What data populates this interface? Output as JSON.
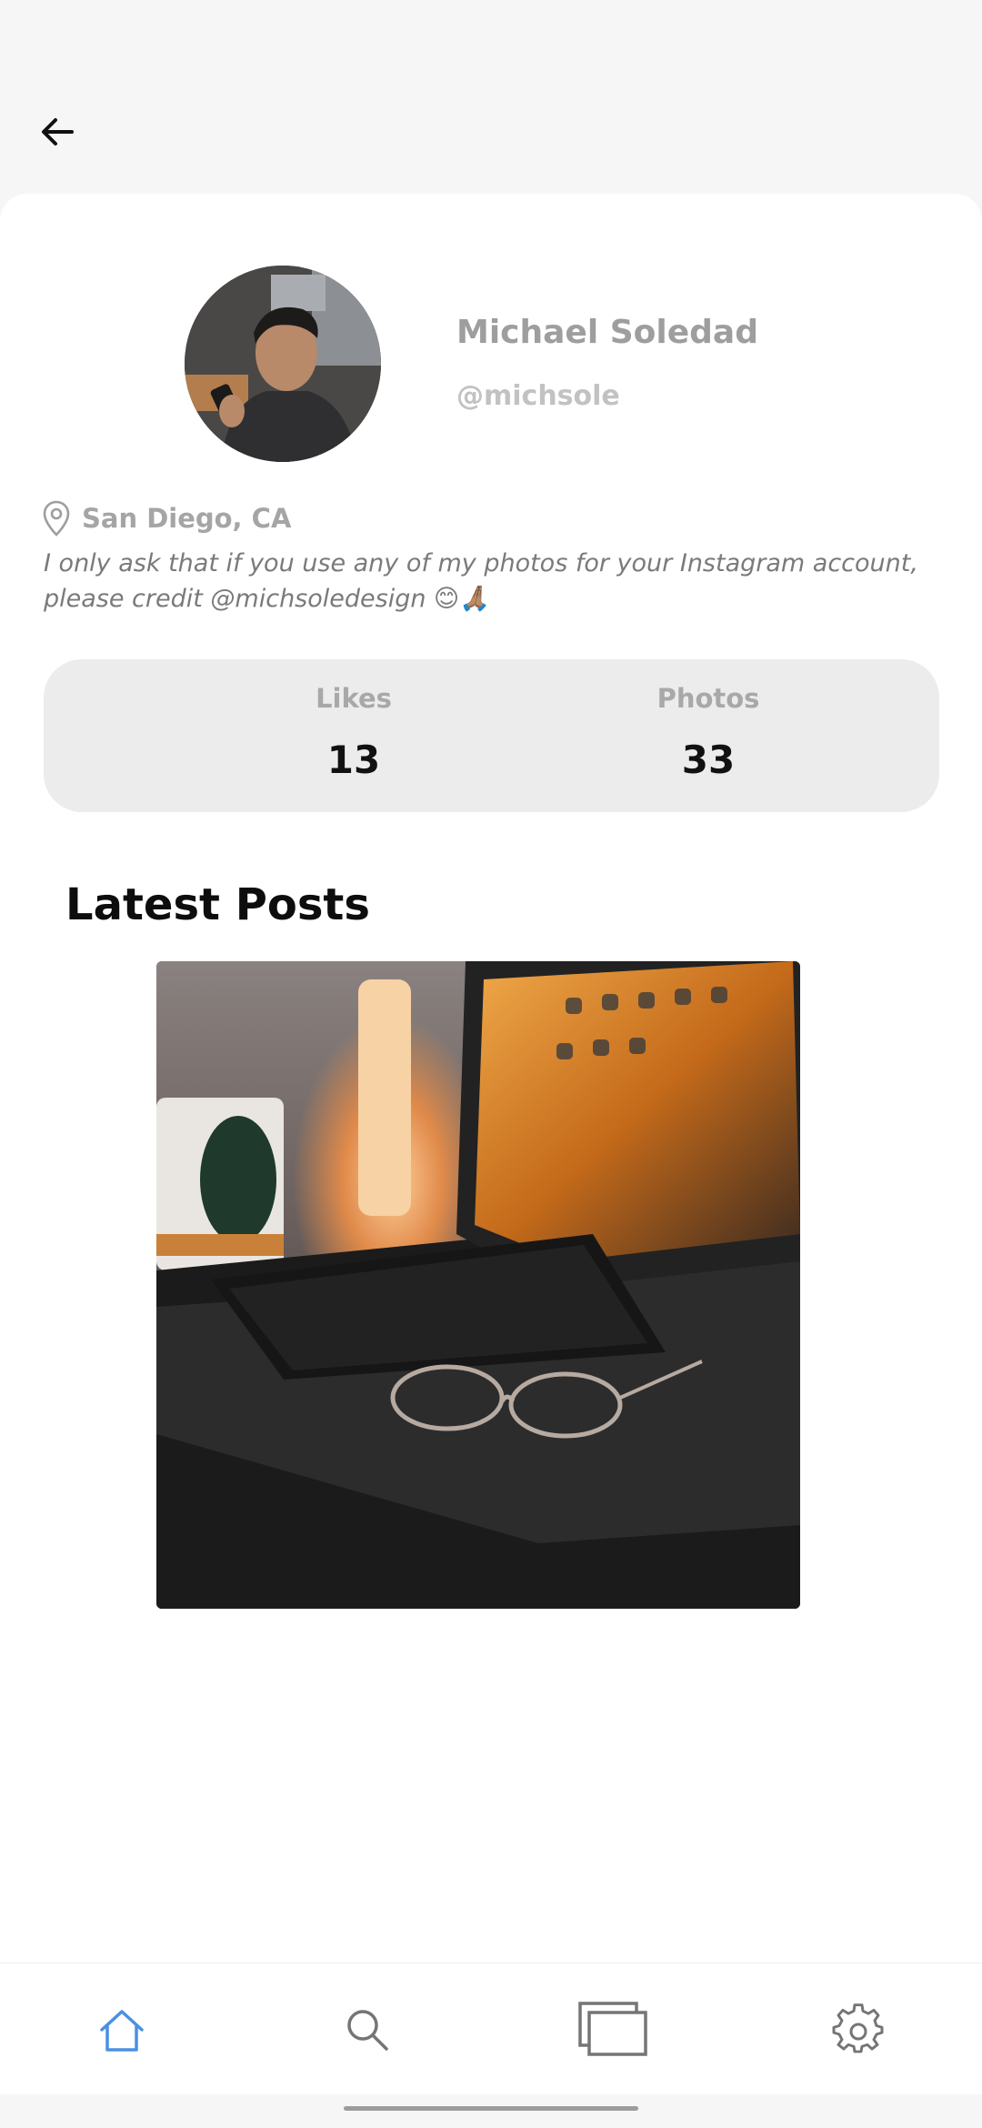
{
  "header": {
    "back_icon": "arrow-left-icon"
  },
  "profile": {
    "name": "Michael Soledad",
    "handle": "@michsole",
    "location": "San Diego, CA",
    "bio": "I only ask that if you use any of my photos for your Instagram account, please credit @michsoledesign 😊🙏🏽"
  },
  "stats": {
    "likes_label": "Likes",
    "likes_value": "13",
    "photos_label": "Photos",
    "photos_value": "33"
  },
  "posts": {
    "title": "Latest Posts"
  },
  "bottom_nav": {
    "items": [
      {
        "icon": "home-icon",
        "active": true
      },
      {
        "icon": "search-icon",
        "active": false
      },
      {
        "icon": "collections-icon",
        "active": false
      },
      {
        "icon": "gear-icon",
        "active": false
      }
    ],
    "active_color": "#4a90e2",
    "inactive_color": "#757575"
  }
}
